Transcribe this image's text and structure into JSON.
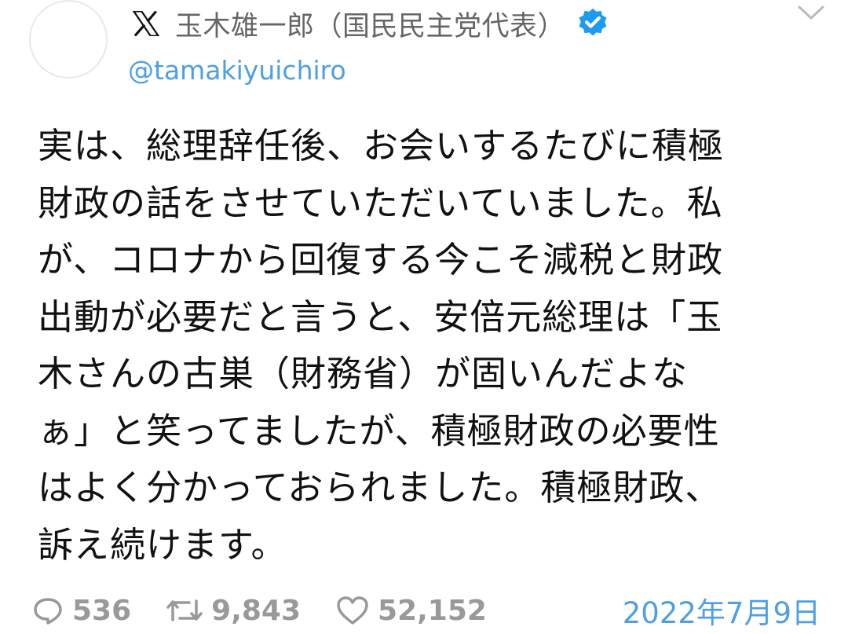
{
  "author": {
    "name": "玉木雄一郎（国民民主党代表）",
    "handle": "@tamakiyuichiro",
    "verified": true,
    "logo_icon": "x-logo-icon"
  },
  "tweet": {
    "text": "実は、総理辞任後、お会いするたびに積極\n財政の話をさせていただいていました。私\nが、コロナから回復する今こそ減税と財政\n出動が必要だと言うと、安倍元総理は「玉\n木さんの古巣（財務省）が固いんだよな\nぁ」と笑ってましたが、積極財政の必要性\nはよく分かっておられました。積極財政、\n訴え続けます。"
  },
  "stats": {
    "replies": "536",
    "retweets": "9,843",
    "likes": "52,152"
  },
  "date": "2022年7月9日",
  "colors": {
    "accent": "#4e9fe3",
    "muted": "#999999",
    "verified": "#1d9bf0"
  }
}
